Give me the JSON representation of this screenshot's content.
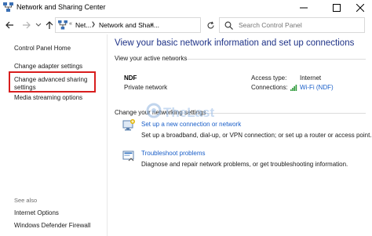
{
  "window": {
    "title": "Network and Sharing Center",
    "controls": {
      "minimize": "minimize-icon",
      "maximize": "maximize-icon",
      "close": "close-icon"
    }
  },
  "navigation": {
    "breadcrumb": [
      "«",
      "Net...",
      "Network and Shari..."
    ],
    "search_placeholder": "Search Control Panel"
  },
  "sidebar": {
    "items": [
      {
        "label": "Control Panel Home"
      },
      {
        "label": "Change adapter settings"
      },
      {
        "label": "Change advanced sharing settings",
        "highlighted": true
      },
      {
        "label": "Media streaming options"
      }
    ],
    "see_also_label": "See also",
    "see_also": [
      {
        "label": "Internet Options"
      },
      {
        "label": "Windows Defender Firewall"
      }
    ]
  },
  "main": {
    "title": "View your basic network information and set up connections",
    "active_networks_label": "View your active networks",
    "network": {
      "name": "NDF",
      "type": "Private network",
      "access_type_label": "Access type:",
      "access_type": "Internet",
      "connections_label": "Connections:",
      "connection": "Wi-Fi (NDF)"
    },
    "change_settings_label": "Change your networking settings",
    "tasks": [
      {
        "icon": "new-connection-icon",
        "title": "Set up a new connection or network",
        "description": "Set up a broadband, dial-up, or VPN connection; or set up a router or access point."
      },
      {
        "icon": "troubleshoot-icon",
        "title": "Troubleshoot problems",
        "description": "Diagnose and repair network problems, or get troubleshooting information."
      }
    ]
  },
  "watermark": {
    "text": "TheLast"
  },
  "colors": {
    "title_blue": "#1e3287",
    "link_blue": "#1a5fc9",
    "highlight_red": "#d81e1e",
    "signal_green": "#2e9a3a"
  }
}
